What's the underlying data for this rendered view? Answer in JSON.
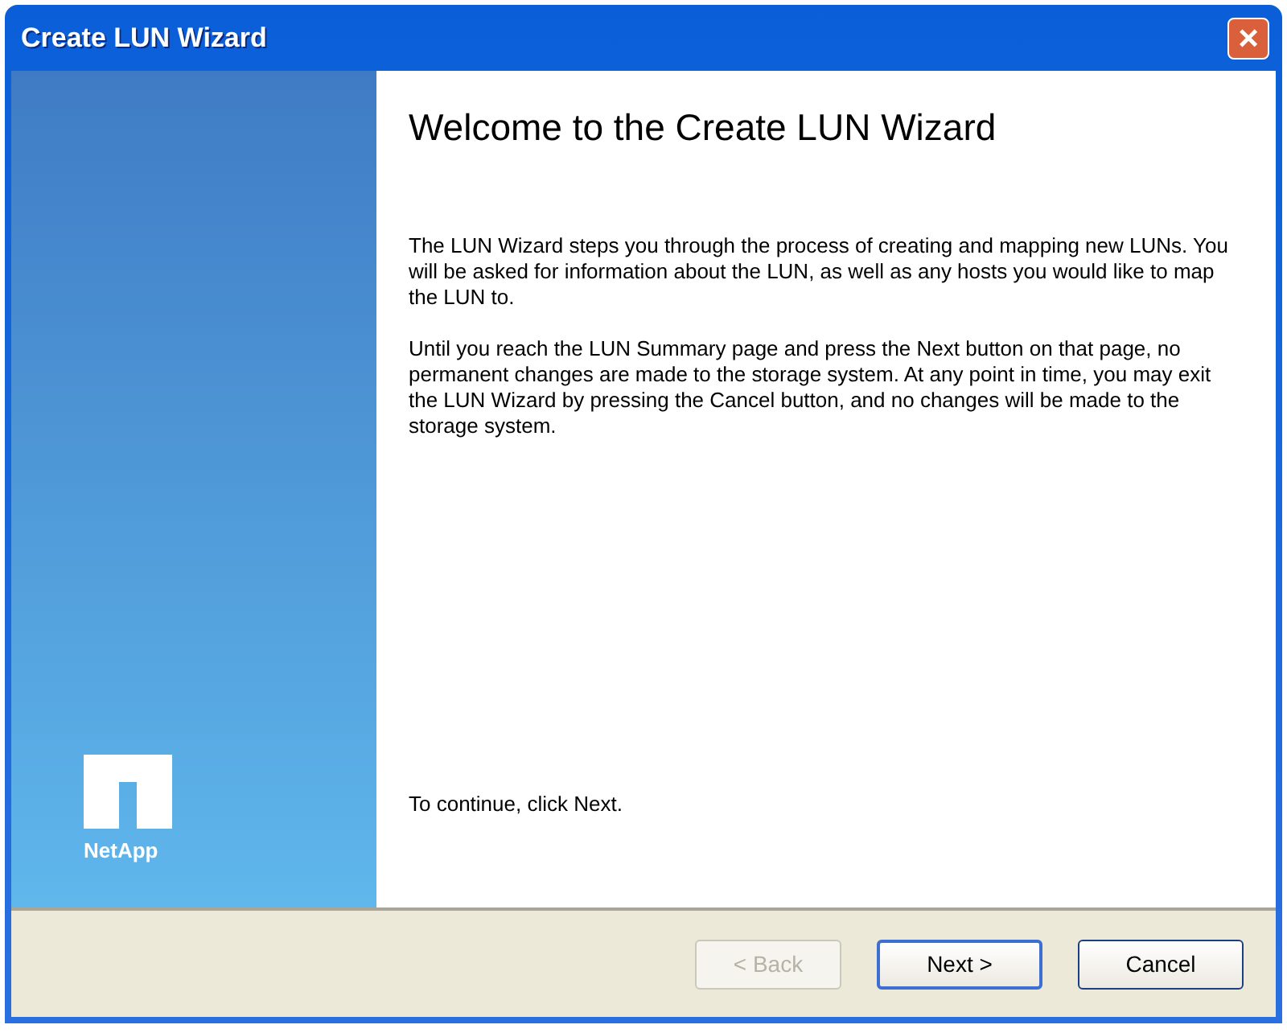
{
  "window": {
    "title": "Create LUN Wizard",
    "close": "×"
  },
  "sidebar": {
    "logo_text": "NetApp"
  },
  "content": {
    "heading": "Welcome to the Create LUN Wizard",
    "paragraphs": [
      "The LUN Wizard steps you through the process of creating and mapping new LUNs. You will be asked for information about the LUN, as well as any hosts you would like to map the LUN to.",
      "Until you reach the LUN Summary page and press the Next button on that page, no permanent changes are made to the storage system. At any point in time, you may exit the LUN Wizard by pressing the Cancel button, and no changes will be made to the storage system."
    ],
    "footer_text": "To continue, click Next."
  },
  "buttons": [
    {
      "label": "< Back",
      "disabled": true,
      "default": false
    },
    {
      "label": "Next >",
      "disabled": false,
      "default": true
    },
    {
      "label": "Cancel",
      "disabled": false,
      "default": false
    }
  ]
}
